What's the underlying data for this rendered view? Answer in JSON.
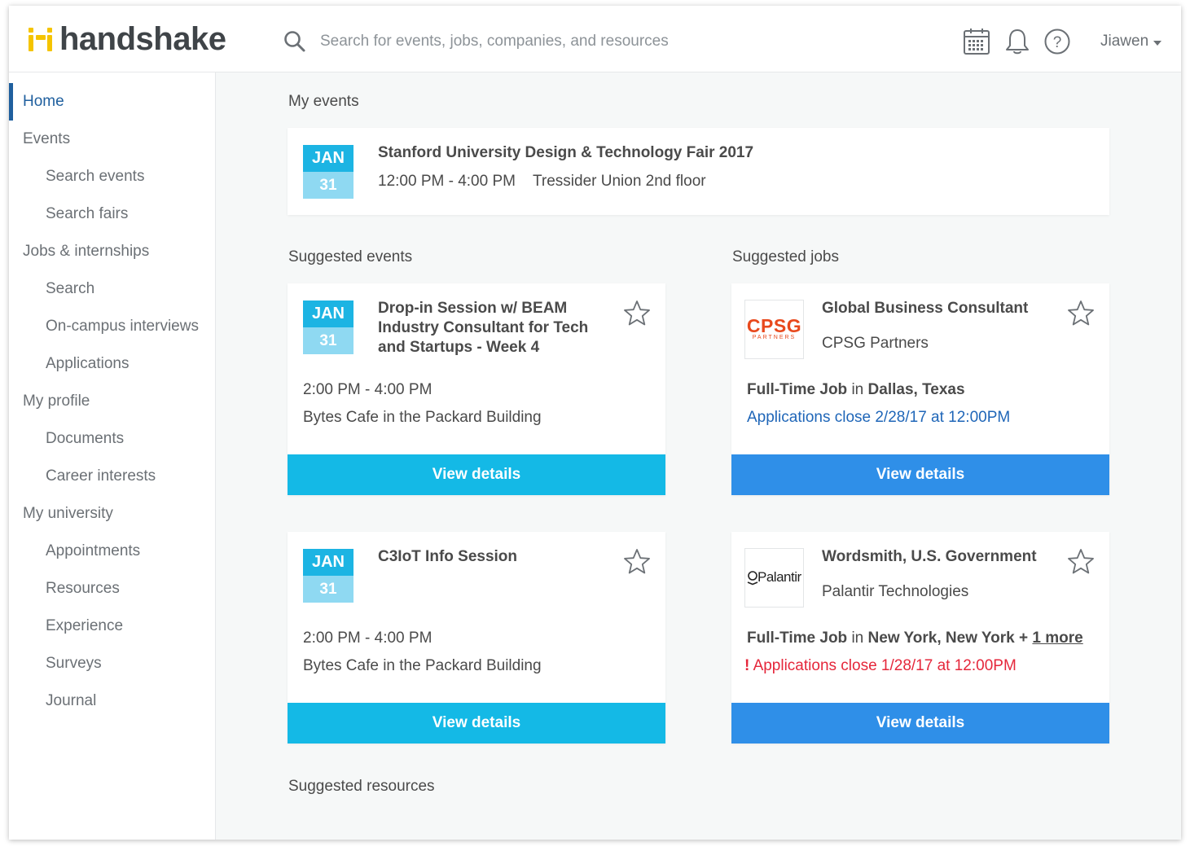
{
  "brand": {
    "name": "handshake",
    "logo_accent": "#f5c400"
  },
  "header": {
    "search_placeholder": "Search for events, jobs, companies, and resources",
    "user_name": "Jiawen"
  },
  "sidebar": {
    "items": [
      {
        "label": "Home",
        "level": "top",
        "active": true
      },
      {
        "label": "Events",
        "level": "top"
      },
      {
        "label": "Search events",
        "level": "sub"
      },
      {
        "label": "Search fairs",
        "level": "sub"
      },
      {
        "label": "Jobs & internships",
        "level": "top"
      },
      {
        "label": "Search",
        "level": "sub"
      },
      {
        "label": "On-campus interviews",
        "level": "sub"
      },
      {
        "label": "Applications",
        "level": "sub"
      },
      {
        "label": "My profile",
        "level": "top"
      },
      {
        "label": "Documents",
        "level": "sub"
      },
      {
        "label": "Career interests",
        "level": "sub"
      },
      {
        "label": "My university",
        "level": "top"
      },
      {
        "label": "Appointments",
        "level": "sub"
      },
      {
        "label": "Resources",
        "level": "sub"
      },
      {
        "label": "Experience",
        "level": "sub"
      },
      {
        "label": "Surveys",
        "level": "sub"
      },
      {
        "label": "Journal",
        "level": "sub"
      }
    ]
  },
  "my_events": {
    "title": "My events",
    "event": {
      "month": "JAN",
      "day": "31",
      "name": "Stanford University Design & Technology Fair 2017",
      "time": "12:00 PM - 4:00 PM",
      "location": "Tressider Union 2nd floor"
    }
  },
  "suggested_events": {
    "title": "Suggested events",
    "items": [
      {
        "month": "JAN",
        "day": "31",
        "name_lines": [
          "Drop-in Session w/ BEAM",
          "Industry Consultant for Tech",
          "and Startups - Week 4"
        ],
        "time": "2:00 PM - 4:00 PM",
        "location": "Bytes Cafe in the Packard Building",
        "button": "View details"
      },
      {
        "month": "JAN",
        "day": "31",
        "name_lines": [
          "C3IoT Info Session"
        ],
        "time": "2:00 PM - 4:00 PM",
        "location": "Bytes Cafe in the Packard Building",
        "button": "View details"
      }
    ]
  },
  "suggested_jobs": {
    "title": "Suggested jobs",
    "items": [
      {
        "logo_text": "CPSG",
        "logo_sub": "PARTNERS",
        "title": "Global Business Consultant",
        "company": "CPSG Partners",
        "job_type": "Full-Time Job",
        "in_word": "in",
        "location": "Dallas, Texas",
        "more": "",
        "deadline": "Applications close 2/28/17 at 12:00PM",
        "urgent": false,
        "button": "View details"
      },
      {
        "logo_text": "Palantir",
        "title": "Wordsmith, U.S. Government",
        "company": "Palantir Technologies",
        "job_type": "Full-Time Job",
        "in_word": "in",
        "location": "New York, New York +",
        "more": "1 more",
        "deadline": "Applications close 1/28/17 at 12:00PM",
        "alert_mark": "!",
        "urgent": true,
        "button": "View details"
      }
    ]
  },
  "suggested_resources": {
    "title": "Suggested resources"
  },
  "colors": {
    "primary_nav": "#1f5f9e",
    "event_button": "#14b9e6",
    "job_button": "#2f8fe8",
    "date_month_bg": "#1cb4e3",
    "date_day_bg": "#8fd9f2",
    "deadline_link": "#1f66b8",
    "deadline_urgent": "#e5273b",
    "cpsg_logo": "#e8491d"
  },
  "icons": [
    "search-icon",
    "calendar-icon",
    "bell-icon",
    "help-icon",
    "chevron-down-icon",
    "star-icon"
  ]
}
